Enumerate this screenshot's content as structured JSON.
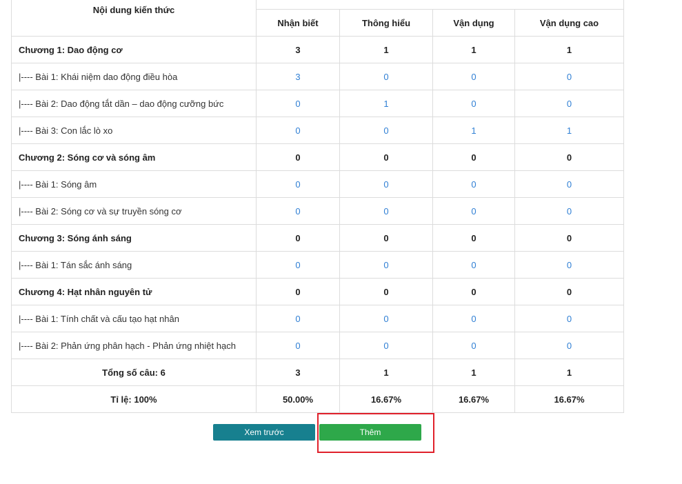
{
  "table": {
    "content_header": "Nội dung kiến thức",
    "level_headers": [
      "Nhận biết",
      "Thông hiểu",
      "Vận dụng",
      "Vận dụng cao"
    ],
    "rows": [
      {
        "type": "chapter",
        "name": "Chương 1: Dao động cơ",
        "values": [
          "3",
          "1",
          "1",
          "1"
        ]
      },
      {
        "type": "lesson",
        "name": "|---- Bài 1: Khái niệm dao động điều hòa",
        "values": [
          "3",
          "0",
          "0",
          "0"
        ]
      },
      {
        "type": "lesson",
        "name": "|---- Bài 2: Dao động tắt dần – dao động cưỡng bức",
        "values": [
          "0",
          "1",
          "0",
          "0"
        ]
      },
      {
        "type": "lesson",
        "name": "|---- Bài 3: Con lắc lò xo",
        "values": [
          "0",
          "0",
          "1",
          "1"
        ]
      },
      {
        "type": "chapter",
        "name": "Chương 2: Sóng cơ và sóng âm",
        "values": [
          "0",
          "0",
          "0",
          "0"
        ]
      },
      {
        "type": "lesson",
        "name": "|---- Bài 1: Sóng âm",
        "values": [
          "0",
          "0",
          "0",
          "0"
        ]
      },
      {
        "type": "lesson",
        "name": "|---- Bài 2: Sóng cơ và sự truyền sóng cơ",
        "values": [
          "0",
          "0",
          "0",
          "0"
        ]
      },
      {
        "type": "chapter",
        "name": "Chương 3: Sóng ánh sáng",
        "values": [
          "0",
          "0",
          "0",
          "0"
        ]
      },
      {
        "type": "lesson",
        "name": "|---- Bài 1: Tán sắc ánh sáng",
        "values": [
          "0",
          "0",
          "0",
          "0"
        ]
      },
      {
        "type": "chapter",
        "name": "Chương 4: Hạt nhân nguyên tử",
        "values": [
          "0",
          "0",
          "0",
          "0"
        ]
      },
      {
        "type": "lesson",
        "name": "|---- Bài 1: Tính chất và cấu tạo hạt nhân",
        "values": [
          "0",
          "0",
          "0",
          "0"
        ]
      },
      {
        "type": "lesson",
        "name": "|---- Bài 2: Phản ứng phân hạch - Phản ứng nhiệt hạch",
        "values": [
          "0",
          "0",
          "0",
          "0"
        ]
      }
    ],
    "total": {
      "label": "Tổng số câu: 6",
      "values": [
        "3",
        "1",
        "1",
        "1"
      ]
    },
    "ratio": {
      "label": "Tỉ lệ: 100%",
      "values": [
        "50.00%",
        "16.67%",
        "16.67%",
        "16.67%"
      ]
    }
  },
  "buttons": {
    "preview_label": "Xem trước",
    "add_label": "Thêm"
  },
  "colors": {
    "preview_button": "#17808f",
    "add_button": "#2ea84a",
    "highlight_border": "#e0202a",
    "link_value": "#2f7fd4"
  }
}
